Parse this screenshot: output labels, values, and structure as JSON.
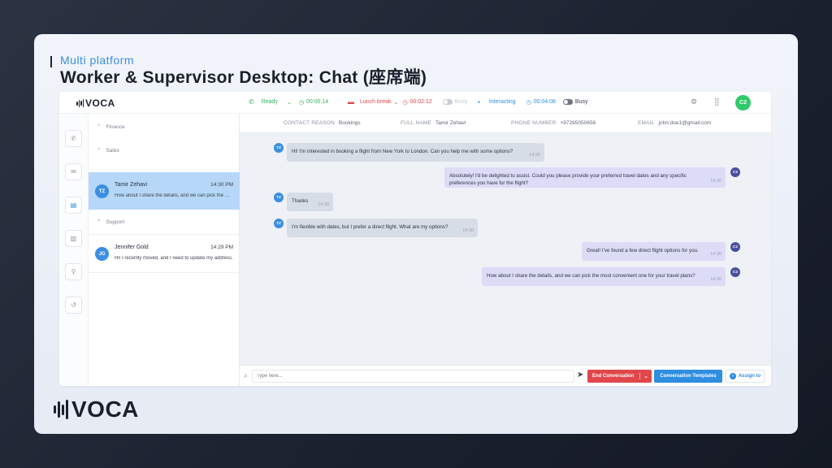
{
  "heading": {
    "subtitle": "Multi platform",
    "title": "Worker & Supervisor Desktop: Chat (座席端)"
  },
  "brand": {
    "logo_text": "VOCA"
  },
  "topbar": {
    "ready_label": "Ready",
    "ready_timer": "00:00:14",
    "lunch_label": "Lunch break",
    "lunch_timer": "00:02:12",
    "lunch_busy_label": "Busy",
    "interacting_label": "Interacting",
    "interacting_timer": "00:04:08",
    "busy_label": "Busy",
    "user_initials": "C2",
    "colors": {
      "ready": "#2fb35a",
      "lunch": "#e0474c",
      "interacting": "#2e8ee0"
    }
  },
  "sidebar_rail": {
    "icons": [
      "phone-icon",
      "mail-icon",
      "chat-icon",
      "stats-icon",
      "network-icon",
      "history-icon"
    ]
  },
  "conversation_list": {
    "groups": [
      {
        "label": "Finance"
      },
      {
        "label": "Sales"
      },
      {
        "label": "Support"
      }
    ],
    "conversations": [
      {
        "initials": "TZ",
        "name": "Tamir Zehavi",
        "time": "14:30 PM",
        "preview": "How about I share the details, and we can pick the most convenient one for your travel plans?",
        "selected": true
      },
      {
        "initials": "JG",
        "name": "Jennifer Gold",
        "time": "14:29 PM",
        "preview": "Hi! I recently moved, and I need to update my address.",
        "selected": false
      }
    ]
  },
  "contact_info": {
    "reason_label": "CONTACT REASON",
    "reason_value": "Bookings",
    "name_label": "FULL NAME",
    "name_value": "Tamir Zehavi",
    "phone_label": "PHONE NUMBER",
    "phone_value": "+97285050656",
    "email_label": "EMAIL",
    "email_value": "john.doe1@gmail.com"
  },
  "messages": [
    {
      "from": "customer",
      "avatar": "TZ",
      "text": "Hi! I'm interested in booking a flight from New York to London. Can you help me with some options?",
      "time": "14:30"
    },
    {
      "from": "agent",
      "avatar": "C2",
      "text": "Absolutely! I'd be delighted to assist. Could you please provide your preferred travel dates and any specific preferences you have for the flight?",
      "time": "14:30"
    },
    {
      "from": "customer",
      "avatar": "TZ",
      "text": "Thanks",
      "time": "14:30"
    },
    {
      "from": "customer",
      "avatar": "TZ",
      "text": "I'm flexible with dates, but I prefer a direct flight. What are my options?",
      "time": "14:30"
    },
    {
      "from": "agent",
      "avatar": "C2",
      "text": "Great! I've found a few direct flight options for you.",
      "time": "14:30"
    },
    {
      "from": "agent",
      "avatar": "C2",
      "text": "How about I share the details, and we can pick the most convenient one for your travel plans?",
      "time": "14:30"
    }
  ],
  "composer": {
    "placeholder": "Type here...",
    "end_label": "End Conversation",
    "templates_label": "Conversation Templates",
    "assign_label": "Assign to"
  }
}
